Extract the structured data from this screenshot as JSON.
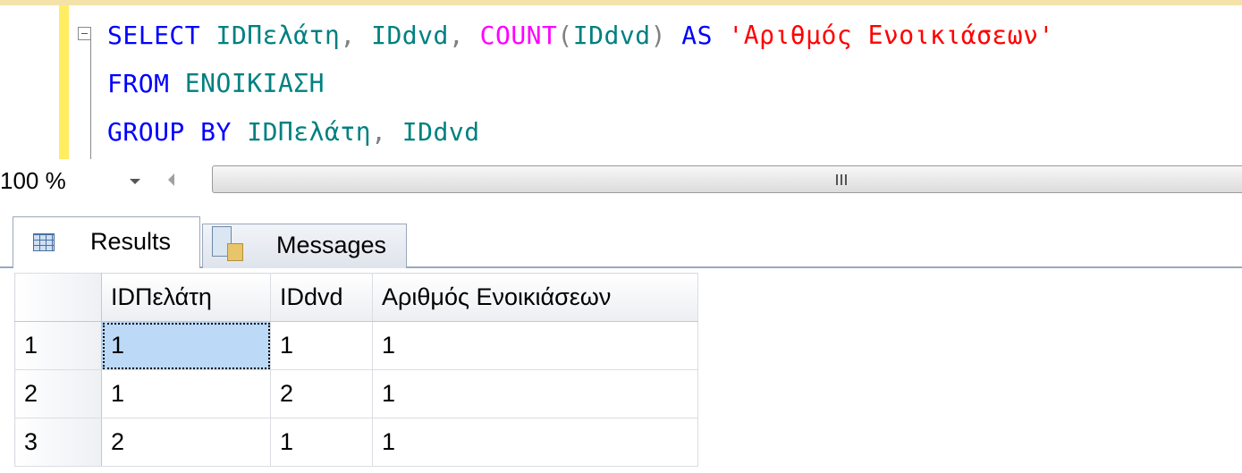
{
  "editor": {
    "lines": [
      {
        "tokens": [
          {
            "text": "SELECT",
            "kind": "kw"
          },
          {
            "text": " IDΠελάτη",
            "kind": "tx"
          },
          {
            "text": ",",
            "kind": "pc"
          },
          {
            "text": " IDdvd",
            "kind": "tx"
          },
          {
            "text": ",",
            "kind": "pc"
          },
          {
            "text": " COUNT",
            "kind": "fn"
          },
          {
            "text": "(",
            "kind": "pc"
          },
          {
            "text": "IDdvd",
            "kind": "tx"
          },
          {
            "text": ")",
            "kind": "pc"
          },
          {
            "text": " AS",
            "kind": "kw"
          },
          {
            "text": " 'Αριθμός Ενοικιάσεων'",
            "kind": "st"
          }
        ]
      },
      {
        "tokens": [
          {
            "text": "FROM",
            "kind": "kw"
          },
          {
            "text": " ΕΝΟΙΚΙΑΣΗ",
            "kind": "tx"
          }
        ]
      },
      {
        "tokens": [
          {
            "text": "GROUP BY",
            "kind": "kw"
          },
          {
            "text": " IDΠελάτη",
            "kind": "tx"
          },
          {
            "text": ",",
            "kind": "pc"
          },
          {
            "text": " IDdvd",
            "kind": "tx"
          }
        ]
      }
    ],
    "colors": {
      "keyword": "#0000ff",
      "function": "#ff00ff",
      "string": "#ff0000",
      "identifier": "#008080",
      "punctuation": "#808080"
    }
  },
  "zoom": {
    "value": "100 %"
  },
  "tabs": [
    {
      "label": "Results",
      "icon": "results-grid-icon",
      "active": true
    },
    {
      "label": "Messages",
      "icon": "messages-icon",
      "active": false
    }
  ],
  "results": {
    "columns": [
      "IDΠελάτη",
      "IDdvd",
      "Αριθμός Ενοικιάσεων"
    ],
    "rows": [
      {
        "num": "1",
        "cells": [
          "1",
          "1",
          "1"
        ]
      },
      {
        "num": "2",
        "cells": [
          "1",
          "2",
          "1"
        ]
      },
      {
        "num": "3",
        "cells": [
          "2",
          "1",
          "1"
        ]
      }
    ],
    "selection_color": "#bcd9f7"
  }
}
